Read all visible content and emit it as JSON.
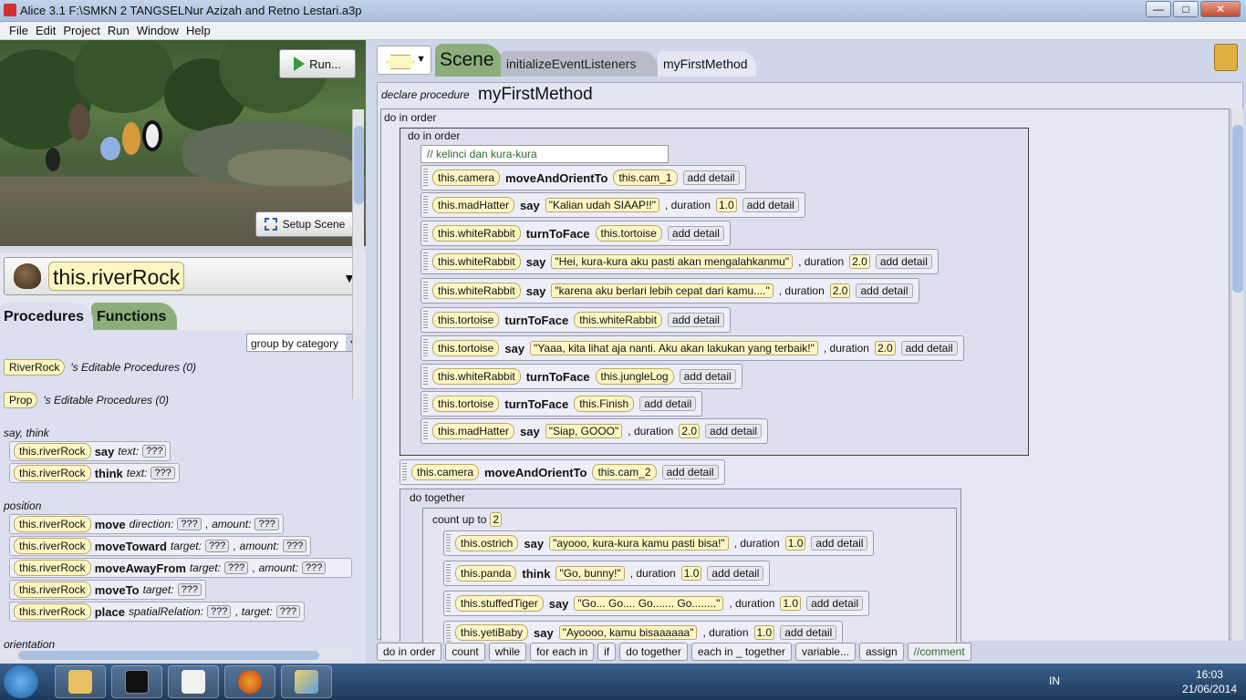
{
  "window": {
    "title": "Alice  3.1 F:\\SMKN 2 TANGSELNur Azizah and Retno Lestari.a3p"
  },
  "menu": [
    "File",
    "Edit",
    "Project",
    "Run",
    "Window",
    "Help"
  ],
  "scene": {
    "run_label": "Run...",
    "setup_label": "Setup Scene"
  },
  "selected_object": "this.riverRock",
  "left_tabs": {
    "procedures": "Procedures",
    "functions": "Functions"
  },
  "group_by": "group by category",
  "editable": [
    {
      "type": "RiverRock",
      "label": "'s Editable Procedures (0)"
    },
    {
      "type": "Prop",
      "label": "'s Editable Procedures (0)"
    }
  ],
  "categories": {
    "say_think": "say, think",
    "position": "position",
    "orientation": "orientation"
  },
  "procedures": [
    {
      "target": "this.riverRock",
      "name": "say",
      "p1": "text:",
      "v1": "???",
      "p2": "",
      "v2": ""
    },
    {
      "target": "this.riverRock",
      "name": "think",
      "p1": "text:",
      "v1": "???",
      "p2": "",
      "v2": ""
    },
    {
      "target": "this.riverRock",
      "name": "move",
      "p1": "direction:",
      "v1": "???",
      "p2": "amount:",
      "v2": "???"
    },
    {
      "target": "this.riverRock",
      "name": "moveToward",
      "p1": "target:",
      "v1": "???",
      "p2": "amount:",
      "v2": "???"
    },
    {
      "target": "this.riverRock",
      "name": "moveAwayFrom",
      "p1": "target:",
      "v1": "???",
      "p2": "amount:",
      "v2": "???"
    },
    {
      "target": "this.riverRock",
      "name": "moveTo",
      "p1": "target:",
      "v1": "???",
      "p2": "",
      "v2": ""
    },
    {
      "target": "this.riverRock",
      "name": "place",
      "p1": "spatialRelation:",
      "v1": "???",
      "p2": "target:",
      "v2": "???"
    }
  ],
  "editor_tabs": {
    "scene": "Scene",
    "init": "initializeEventListeners",
    "method": "myFirstMethod"
  },
  "method": {
    "declare": "declare procedure",
    "name": "myFirstMethod"
  },
  "blocks": {
    "do_in_order": "do in order",
    "do_together": "do together",
    "count_up_to": "count up to",
    "count_value": "2"
  },
  "comment": "// kelinci dan kura-kura",
  "add_detail": "add detail",
  "duration_label": ", duration",
  "inner_statements": [
    {
      "obj": "this.camera",
      "method": "moveAndOrientTo",
      "arg": "this.cam_1",
      "str": "",
      "dur": ""
    },
    {
      "obj": "this.madHatter",
      "method": "say",
      "arg": "",
      "str": "\"Kalian udah SIAAP!!\"",
      "dur": "1.0"
    },
    {
      "obj": "this.whiteRabbit",
      "method": "turnToFace",
      "arg": "this.tortoise",
      "str": "",
      "dur": ""
    },
    {
      "obj": "this.whiteRabbit",
      "method": "say",
      "arg": "",
      "str": "\"Hei, kura-kura aku pasti akan mengalahkanmu\"",
      "dur": "2.0"
    },
    {
      "obj": "this.whiteRabbit",
      "method": "say",
      "arg": "",
      "str": "\"karena aku berlari lebih cepat dari kamu....\"",
      "dur": "2.0"
    },
    {
      "obj": "this.tortoise",
      "method": "turnToFace",
      "arg": "this.whiteRabbit",
      "str": "",
      "dur": ""
    },
    {
      "obj": "this.tortoise",
      "method": "say",
      "arg": "",
      "str": "\"Yaaa, kita lihat aja nanti. Aku akan lakukan yang terbaik!\"",
      "dur": "2.0"
    },
    {
      "obj": "this.whiteRabbit",
      "method": "turnToFace",
      "arg": "this.jungleLog",
      "str": "",
      "dur": ""
    },
    {
      "obj": "this.tortoise",
      "method": "turnToFace",
      "arg": "this.Finish",
      "str": "",
      "dur": ""
    },
    {
      "obj": "this.madHatter",
      "method": "say",
      "arg": "",
      "str": "\"Siap, GOOO\"",
      "dur": "2.0"
    }
  ],
  "outer_statement": {
    "obj": "this.camera",
    "method": "moveAndOrientTo",
    "arg": "this.cam_2"
  },
  "loop_statements": [
    {
      "obj": "this.ostrich",
      "method": "say",
      "str": "\"ayooo, kura-kura kamu pasti bisa!\"",
      "dur": "1.0"
    },
    {
      "obj": "this.panda",
      "method": "think",
      "str": "\"Go, bunny!\"",
      "dur": "1.0"
    },
    {
      "obj": "this.stuffedTiger",
      "method": "say",
      "str": "\"Go... Go.... Go....... Go........\"",
      "dur": "1.0"
    },
    {
      "obj": "this.yetiBaby",
      "method": "say",
      "str": "\"Ayoooo, kamu bisaaaaaa\"",
      "dur": "1.0"
    }
  ],
  "footer": [
    "do in order",
    "count",
    "while",
    "for each in",
    "if",
    "do together",
    "each in _ together",
    "variable...",
    "assign",
    "//comment"
  ],
  "taskbar": {
    "lang": "IN",
    "time": "16:03",
    "date": "21/06/2014"
  }
}
